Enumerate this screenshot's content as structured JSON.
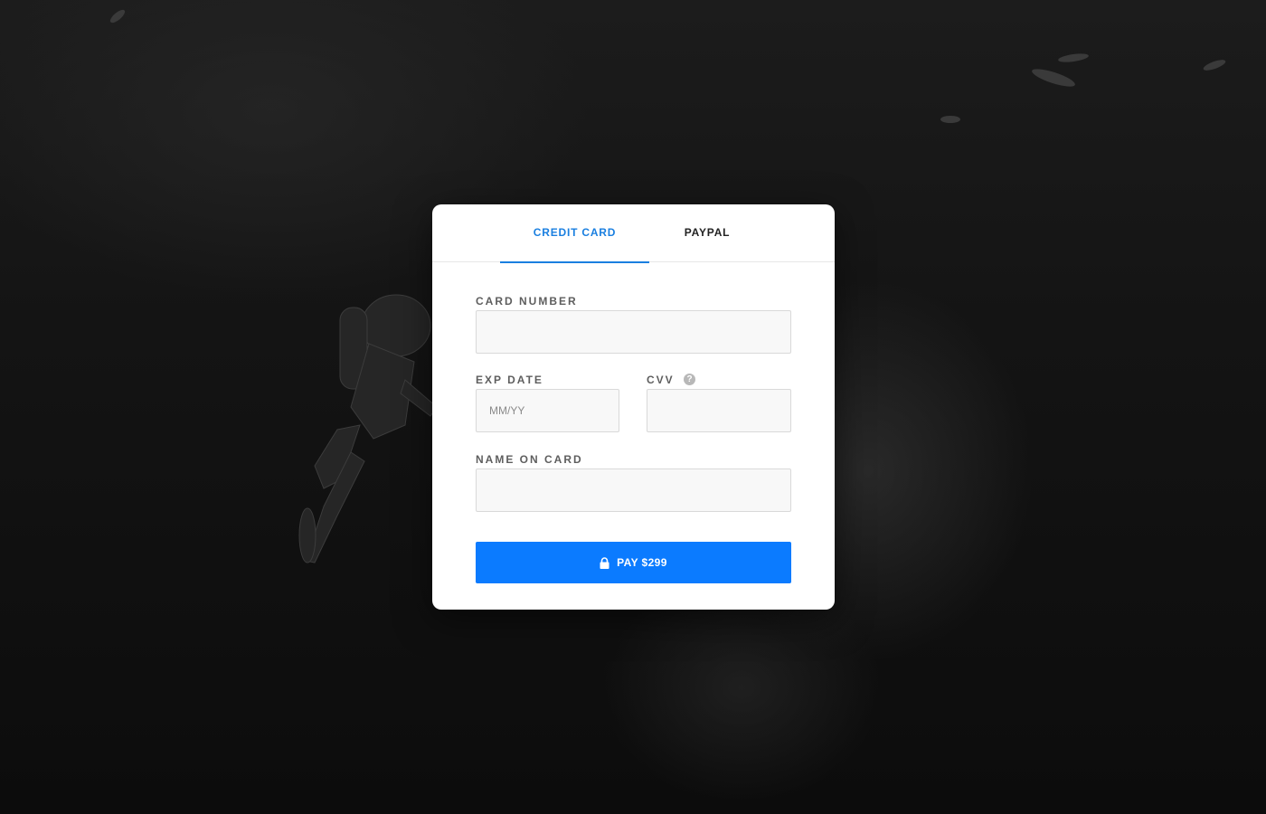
{
  "tabs": [
    {
      "label": "CREDIT CARD",
      "active": true
    },
    {
      "label": "PAYPAL",
      "active": false
    }
  ],
  "form": {
    "card_number": {
      "label": "CARD NUMBER",
      "value": "",
      "placeholder": ""
    },
    "exp_date": {
      "label": "EXP DATE",
      "value": "",
      "placeholder": "MM/YY"
    },
    "cvv": {
      "label": "CVV",
      "value": "",
      "placeholder": "",
      "help_icon": "question-circle-icon"
    },
    "name_on_card": {
      "label": "NAME ON CARD",
      "value": "",
      "placeholder": ""
    }
  },
  "pay_button": {
    "label": "PAY $299",
    "icon": "lock-icon"
  },
  "colors": {
    "accent": "#1a7fe0",
    "button": "#0b7bff",
    "label": "#5e5e5e",
    "input_bg": "#f8f8f8"
  }
}
